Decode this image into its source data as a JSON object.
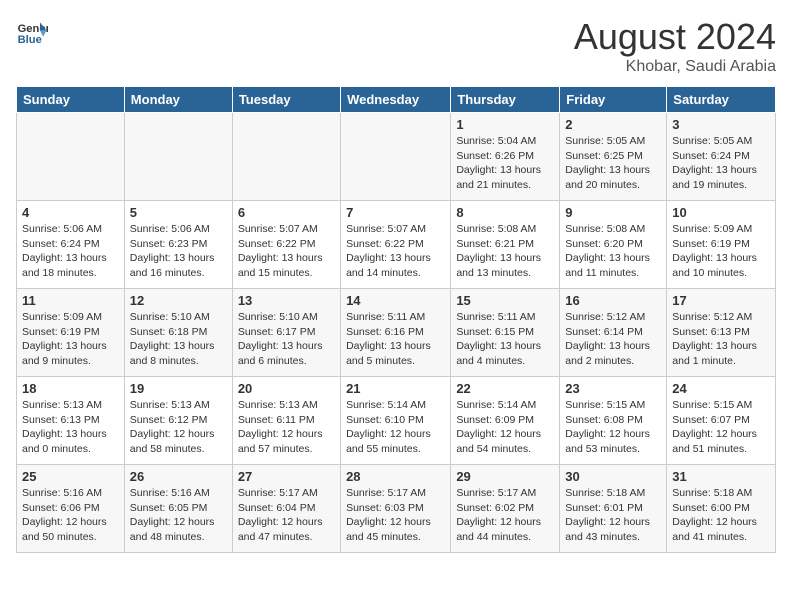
{
  "header": {
    "logo_line1": "General",
    "logo_line2": "Blue",
    "main_title": "August 2024",
    "subtitle": "Khobar, Saudi Arabia"
  },
  "weekdays": [
    "Sunday",
    "Monday",
    "Tuesday",
    "Wednesday",
    "Thursday",
    "Friday",
    "Saturday"
  ],
  "weeks": [
    [
      {
        "day": "",
        "sunrise": "",
        "sunset": "",
        "daylight": ""
      },
      {
        "day": "",
        "sunrise": "",
        "sunset": "",
        "daylight": ""
      },
      {
        "day": "",
        "sunrise": "",
        "sunset": "",
        "daylight": ""
      },
      {
        "day": "",
        "sunrise": "",
        "sunset": "",
        "daylight": ""
      },
      {
        "day": "1",
        "sunrise": "Sunrise: 5:04 AM",
        "sunset": "Sunset: 6:26 PM",
        "daylight": "Daylight: 13 hours and 21 minutes."
      },
      {
        "day": "2",
        "sunrise": "Sunrise: 5:05 AM",
        "sunset": "Sunset: 6:25 PM",
        "daylight": "Daylight: 13 hours and 20 minutes."
      },
      {
        "day": "3",
        "sunrise": "Sunrise: 5:05 AM",
        "sunset": "Sunset: 6:24 PM",
        "daylight": "Daylight: 13 hours and 19 minutes."
      }
    ],
    [
      {
        "day": "4",
        "sunrise": "Sunrise: 5:06 AM",
        "sunset": "Sunset: 6:24 PM",
        "daylight": "Daylight: 13 hours and 18 minutes."
      },
      {
        "day": "5",
        "sunrise": "Sunrise: 5:06 AM",
        "sunset": "Sunset: 6:23 PM",
        "daylight": "Daylight: 13 hours and 16 minutes."
      },
      {
        "day": "6",
        "sunrise": "Sunrise: 5:07 AM",
        "sunset": "Sunset: 6:22 PM",
        "daylight": "Daylight: 13 hours and 15 minutes."
      },
      {
        "day": "7",
        "sunrise": "Sunrise: 5:07 AM",
        "sunset": "Sunset: 6:22 PM",
        "daylight": "Daylight: 13 hours and 14 minutes."
      },
      {
        "day": "8",
        "sunrise": "Sunrise: 5:08 AM",
        "sunset": "Sunset: 6:21 PM",
        "daylight": "Daylight: 13 hours and 13 minutes."
      },
      {
        "day": "9",
        "sunrise": "Sunrise: 5:08 AM",
        "sunset": "Sunset: 6:20 PM",
        "daylight": "Daylight: 13 hours and 11 minutes."
      },
      {
        "day": "10",
        "sunrise": "Sunrise: 5:09 AM",
        "sunset": "Sunset: 6:19 PM",
        "daylight": "Daylight: 13 hours and 10 minutes."
      }
    ],
    [
      {
        "day": "11",
        "sunrise": "Sunrise: 5:09 AM",
        "sunset": "Sunset: 6:19 PM",
        "daylight": "Daylight: 13 hours and 9 minutes."
      },
      {
        "day": "12",
        "sunrise": "Sunrise: 5:10 AM",
        "sunset": "Sunset: 6:18 PM",
        "daylight": "Daylight: 13 hours and 8 minutes."
      },
      {
        "day": "13",
        "sunrise": "Sunrise: 5:10 AM",
        "sunset": "Sunset: 6:17 PM",
        "daylight": "Daylight: 13 hours and 6 minutes."
      },
      {
        "day": "14",
        "sunrise": "Sunrise: 5:11 AM",
        "sunset": "Sunset: 6:16 PM",
        "daylight": "Daylight: 13 hours and 5 minutes."
      },
      {
        "day": "15",
        "sunrise": "Sunrise: 5:11 AM",
        "sunset": "Sunset: 6:15 PM",
        "daylight": "Daylight: 13 hours and 4 minutes."
      },
      {
        "day": "16",
        "sunrise": "Sunrise: 5:12 AM",
        "sunset": "Sunset: 6:14 PM",
        "daylight": "Daylight: 13 hours and 2 minutes."
      },
      {
        "day": "17",
        "sunrise": "Sunrise: 5:12 AM",
        "sunset": "Sunset: 6:13 PM",
        "daylight": "Daylight: 13 hours and 1 minute."
      }
    ],
    [
      {
        "day": "18",
        "sunrise": "Sunrise: 5:13 AM",
        "sunset": "Sunset: 6:13 PM",
        "daylight": "Daylight: 13 hours and 0 minutes."
      },
      {
        "day": "19",
        "sunrise": "Sunrise: 5:13 AM",
        "sunset": "Sunset: 6:12 PM",
        "daylight": "Daylight: 12 hours and 58 minutes."
      },
      {
        "day": "20",
        "sunrise": "Sunrise: 5:13 AM",
        "sunset": "Sunset: 6:11 PM",
        "daylight": "Daylight: 12 hours and 57 minutes."
      },
      {
        "day": "21",
        "sunrise": "Sunrise: 5:14 AM",
        "sunset": "Sunset: 6:10 PM",
        "daylight": "Daylight: 12 hours and 55 minutes."
      },
      {
        "day": "22",
        "sunrise": "Sunrise: 5:14 AM",
        "sunset": "Sunset: 6:09 PM",
        "daylight": "Daylight: 12 hours and 54 minutes."
      },
      {
        "day": "23",
        "sunrise": "Sunrise: 5:15 AM",
        "sunset": "Sunset: 6:08 PM",
        "daylight": "Daylight: 12 hours and 53 minutes."
      },
      {
        "day": "24",
        "sunrise": "Sunrise: 5:15 AM",
        "sunset": "Sunset: 6:07 PM",
        "daylight": "Daylight: 12 hours and 51 minutes."
      }
    ],
    [
      {
        "day": "25",
        "sunrise": "Sunrise: 5:16 AM",
        "sunset": "Sunset: 6:06 PM",
        "daylight": "Daylight: 12 hours and 50 minutes."
      },
      {
        "day": "26",
        "sunrise": "Sunrise: 5:16 AM",
        "sunset": "Sunset: 6:05 PM",
        "daylight": "Daylight: 12 hours and 48 minutes."
      },
      {
        "day": "27",
        "sunrise": "Sunrise: 5:17 AM",
        "sunset": "Sunset: 6:04 PM",
        "daylight": "Daylight: 12 hours and 47 minutes."
      },
      {
        "day": "28",
        "sunrise": "Sunrise: 5:17 AM",
        "sunset": "Sunset: 6:03 PM",
        "daylight": "Daylight: 12 hours and 45 minutes."
      },
      {
        "day": "29",
        "sunrise": "Sunrise: 5:17 AM",
        "sunset": "Sunset: 6:02 PM",
        "daylight": "Daylight: 12 hours and 44 minutes."
      },
      {
        "day": "30",
        "sunrise": "Sunrise: 5:18 AM",
        "sunset": "Sunset: 6:01 PM",
        "daylight": "Daylight: 12 hours and 43 minutes."
      },
      {
        "day": "31",
        "sunrise": "Sunrise: 5:18 AM",
        "sunset": "Sunset: 6:00 PM",
        "daylight": "Daylight: 12 hours and 41 minutes."
      }
    ]
  ]
}
